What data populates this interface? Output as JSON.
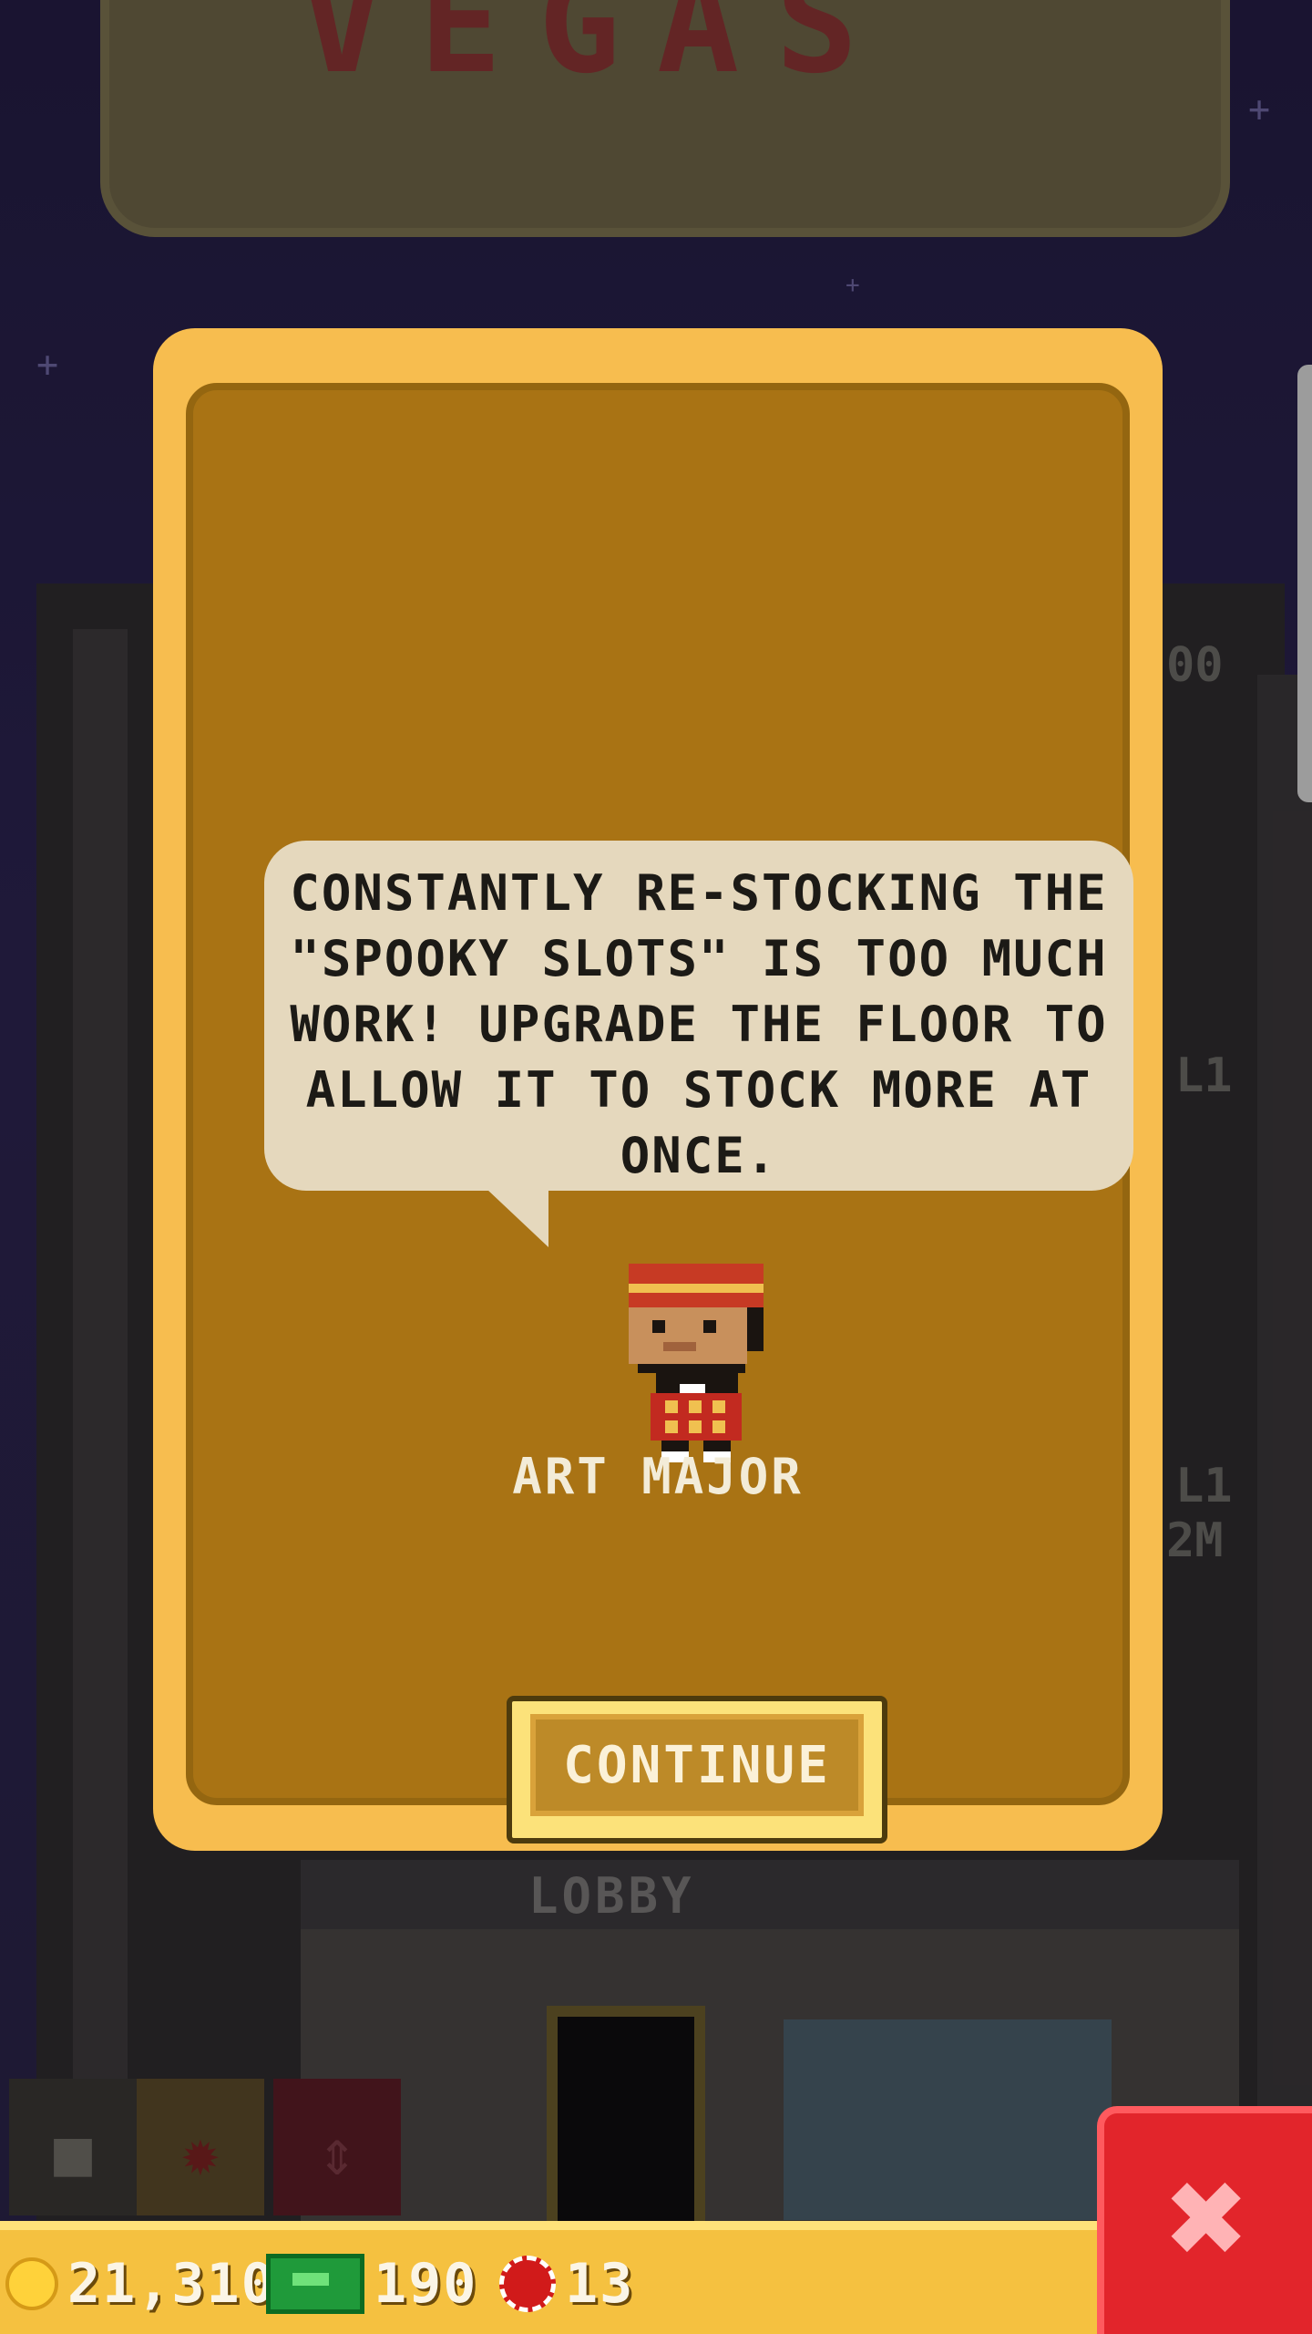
{
  "background": {
    "sign_text": "VEGAS",
    "lobby_label": "LOBBY",
    "floor_labels": [
      "00",
      "L1",
      "L1",
      "2M"
    ]
  },
  "dialog": {
    "message": "CONSTANTLY RE-STOCKING THE \"SPOOKY SLOTS\" IS TOO MUCH WORK! UPGRADE THE FLOOR TO ALLOW IT TO STOCK MORE AT ONCE.",
    "character_name": "ART MAJOR",
    "continue_label": "CONTINUE"
  },
  "currency": {
    "coins": "21,310",
    "cash": "190",
    "chips": "13"
  },
  "icons": {
    "coin": "coin-icon",
    "cash": "cash-icon",
    "chips": "poker-chip-icon",
    "close": "close-icon"
  },
  "colors": {
    "dialog_border": "#f7bd4f",
    "dialog_fill": "#a97314",
    "bubble": "#e5d8bd",
    "close_button": "#e2252b",
    "currency_bar": "#f5c140"
  }
}
